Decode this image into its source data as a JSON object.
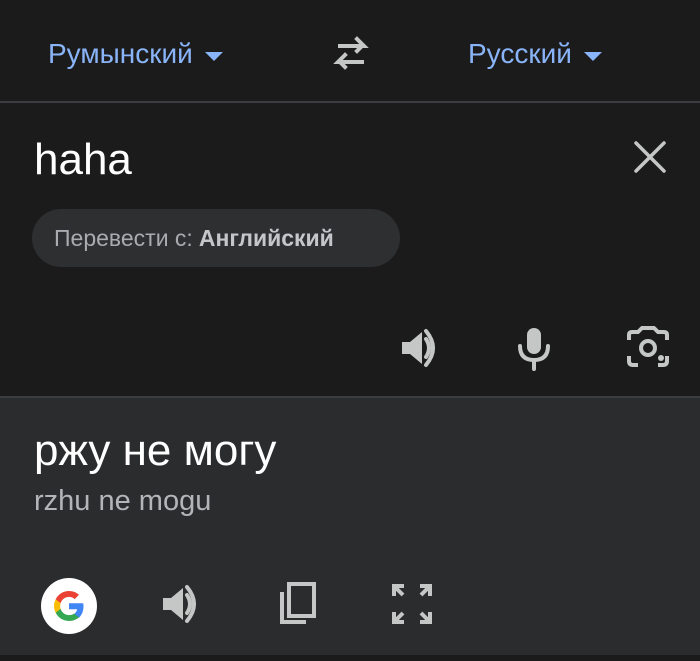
{
  "header": {
    "source_language": "Румынский",
    "target_language": "Русский",
    "swap_icon": "swap-arrows-icon"
  },
  "input": {
    "text": "haha",
    "detect_prefix": "Перевести с:",
    "detected_language": "Английский",
    "icons": [
      "close-icon",
      "speaker-icon",
      "microphone-icon",
      "camera-icon"
    ]
  },
  "output": {
    "text": "ржу не могу",
    "transliteration": "rzhu ne mogu",
    "icons": [
      "google-logo",
      "speaker-icon",
      "copy-icon",
      "fullscreen-icon"
    ]
  },
  "colors": {
    "accent": "#8ab4f8",
    "background": "#1b1b1c",
    "output_background": "#2b2c2e",
    "icon": "#c4c7c5"
  }
}
